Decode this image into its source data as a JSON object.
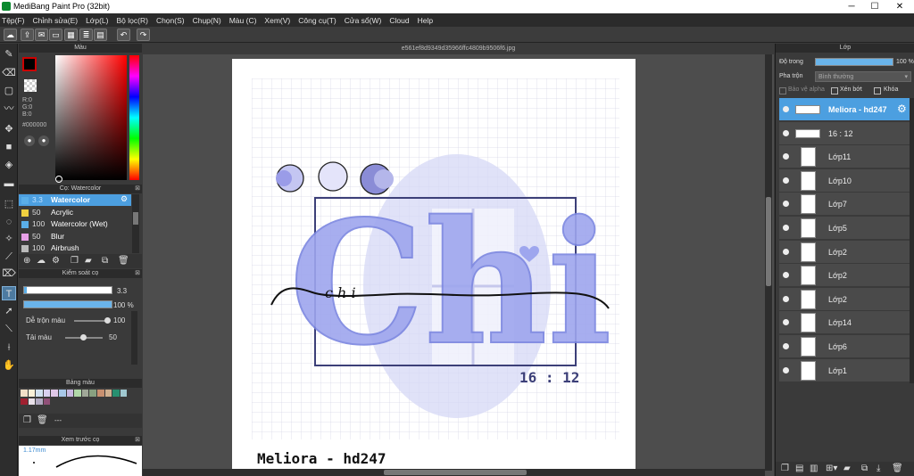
{
  "window": {
    "title": "MediBang Paint Pro (32bit)",
    "minimize": "─",
    "maximize": "☐",
    "close": "✕"
  },
  "menu": [
    "Tệp(F)",
    "Chỉnh sửa(E)",
    "Lớp(L)",
    "Bộ lọc(R)",
    "Chọn(S)",
    "Chụp(N)",
    "Màu (C)",
    "Xem(V)",
    "Công cụ(T)",
    "Cửa sổ(W)",
    "Cloud",
    "Help"
  ],
  "document_tab": "e561ef8d9349d35966ffc4809b9506f6.jpg",
  "color_panel": {
    "title": "Màu",
    "r": "R:0",
    "g": "G:0",
    "b": "B:0",
    "hex": "#000000"
  },
  "brush_panel": {
    "title": "Cọ: Watercolor",
    "items": [
      {
        "size": "3.3",
        "name": "Watercolor",
        "selected": true,
        "color": "#5aaee8"
      },
      {
        "size": "50",
        "name": "Acrylic",
        "color": "#f0d040"
      },
      {
        "size": "100",
        "name": "Watercolor (Wet)",
        "color": "#5aaee8"
      },
      {
        "size": "50",
        "name": "Blur",
        "color": "#e8a0e8"
      },
      {
        "size": "100",
        "name": "Airbrush",
        "color": "#bbbbbb"
      }
    ]
  },
  "brush_control": {
    "title": "Kiểm soát cọ",
    "size": "3.3",
    "opacity": "100 %",
    "opacity_fraction": 1.0,
    "mix_label": "Dễ trộn màu",
    "mix_value": "100",
    "mix_fraction": 1.0,
    "reload_label": "Tải màu",
    "reload_value": "50",
    "reload_fraction": 0.5
  },
  "palette": {
    "title": "Bảng màu",
    "row1": [
      "#f4e0c8",
      "#f8f0d8",
      "#d0e0f0",
      "#d8d0f0",
      "#e0c8e8",
      "#a8c8e8",
      "#c8b8e0",
      "#b0d8a8",
      "#a0a898",
      "#88a080",
      "#c89070",
      "#d0b090",
      "#289070",
      "#a0c8d0"
    ],
    "row2": [
      "#a02030",
      "#e8e0e8",
      "#b0a8c0",
      "#905078"
    ],
    "dash": "---"
  },
  "brush_preview": {
    "title": "Xem trước cọ",
    "size": "1.17mm"
  },
  "artwork": {
    "title": "Chi",
    "cursive": "c h i",
    "time": "16 : 12",
    "signature": "Meliora - hd247"
  },
  "layers": {
    "title": "Lớp",
    "opacity_label": "Độ trong",
    "opacity_value": "100 %",
    "opacity_fraction": 1.0,
    "blend_label": "Pha trộn",
    "blend_value": "Bình thường",
    "protect_alpha": "Bảo vệ alpha",
    "clipping": "Xén bớt",
    "lock": "Khóa",
    "items": [
      {
        "name": "Meliora - hd247",
        "selected": true
      },
      {
        "name": "16 : 12"
      },
      {
        "name": "Lớp11"
      },
      {
        "name": "Lớp10"
      },
      {
        "name": "Lớp7"
      },
      {
        "name": "Lớp5"
      },
      {
        "name": "Lớp2"
      },
      {
        "name": "Lớp2"
      },
      {
        "name": "Lớp2"
      },
      {
        "name": "Lớp14"
      },
      {
        "name": "Lớp6"
      },
      {
        "name": "Lớp1"
      }
    ]
  }
}
